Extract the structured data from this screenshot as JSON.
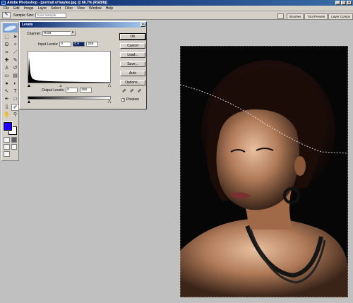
{
  "titlebar": {
    "text": "Adobe Photoshop - [portrait of kaylee.jpg @ 66.7% (RGB/8)]",
    "buttons": [
      "_",
      "□",
      "×"
    ]
  },
  "menu": [
    "File",
    "Edit",
    "Image",
    "Layer",
    "Select",
    "Filter",
    "View",
    "Window",
    "Help"
  ],
  "options": {
    "sample_size_label": "Sample Size:",
    "sample_size_value": "Point Sample"
  },
  "palette_well": [
    "Brushes",
    "Tool Presets",
    "Layer Comps"
  ],
  "levels": {
    "title": "Levels",
    "channel_label": "Channel:",
    "channel_value": "RGB",
    "input_label": "Input Levels:",
    "input_black": "0",
    "input_gamma": "0.5",
    "input_white": "255",
    "output_label": "Output Levels:",
    "output_black": "0",
    "output_white": "255",
    "buttons": {
      "ok": "OK",
      "cancel": "Cancel",
      "load": "Load...",
      "save": "Save...",
      "auto": "Auto",
      "options": "Options..."
    },
    "preview_label": "Preview",
    "preview_checked": true
  },
  "colors": {
    "foreground": "#2200ff",
    "background": "#ffffff",
    "title_gradient_start": "#0a246a"
  },
  "icons": {
    "tools": [
      "marquee-icon",
      "move-icon",
      "lasso-icon",
      "magic-wand-icon",
      "crop-icon",
      "slice-icon",
      "healing-brush-icon",
      "brush-icon",
      "clone-stamp-icon",
      "history-brush-icon",
      "eraser-icon",
      "gradient-icon",
      "blur-icon",
      "dodge-icon",
      "path-selection-icon",
      "type-icon",
      "pen-icon",
      "shape-icon",
      "notes-icon",
      "eyedropper-icon",
      "hand-icon",
      "zoom-icon"
    ]
  }
}
